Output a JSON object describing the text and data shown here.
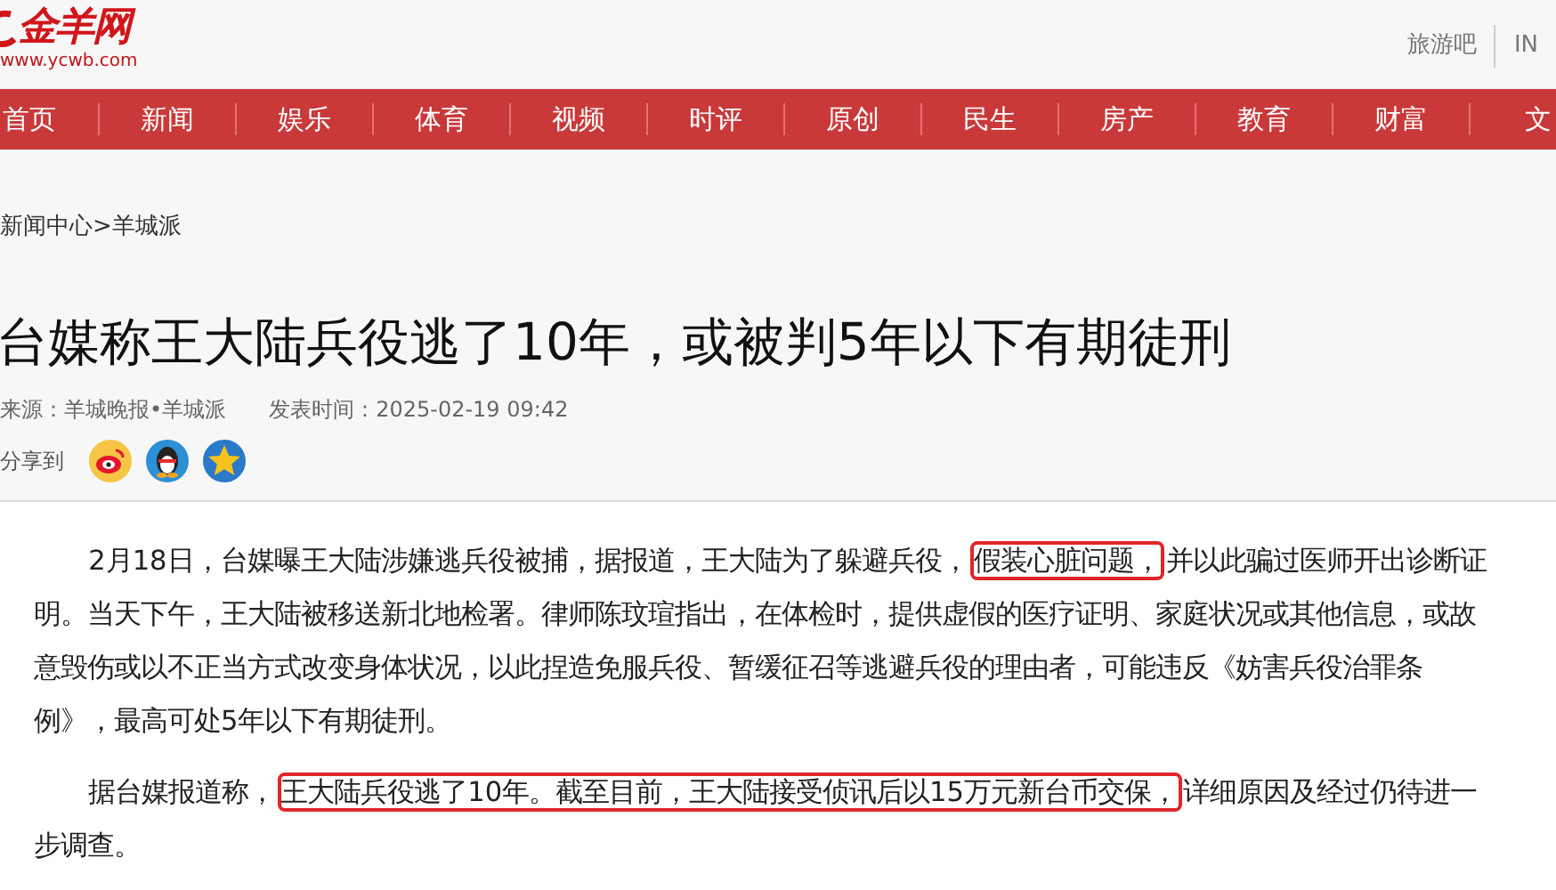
{
  "header": {
    "logo": "金羊网",
    "logo_url": "www.ycwb.com",
    "top_links": [
      "旅游吧",
      "IN"
    ]
  },
  "nav": [
    {
      "label": "首页"
    },
    {
      "label": "新闻"
    },
    {
      "label": "娱乐"
    },
    {
      "label": "体育"
    },
    {
      "label": "视频"
    },
    {
      "label": "时评"
    },
    {
      "label": "原创"
    },
    {
      "label": "民生"
    },
    {
      "label": "房产"
    },
    {
      "label": "教育"
    },
    {
      "label": "财富"
    },
    {
      "label": "文"
    }
  ],
  "breadcrumb": "新闻中心>羊城派",
  "article": {
    "title": "台媒称王大陆兵役逃了10年，或被判5年以下有期徒刑",
    "source": "来源：羊城晚报•羊城派",
    "time": "发表时间：2025-02-19 09:42",
    "share_label": "分享到",
    "share": [
      {
        "kind": "weibo"
      },
      {
        "kind": "qq"
      },
      {
        "kind": "qzone"
      }
    ],
    "paragraphs": [
      [
        {
          "text": "2月18日，台媒曝王大陆涉嫌逃兵役被捕，据报道，王大陆为了躲避兵役，",
          "highlighted": false
        },
        {
          "text": "假装心脏问题，",
          "highlighted": true
        },
        {
          "text": "并以此骗过医师开出诊断证明。当天下午，王大陆被移送新北地检署。律师陈玟瑄指出，在体检时，提供虚假的医疗证明、家庭状况或其他信息，或故意毁伤或以不正当方式改变身体状况，以此捏造免服兵役、暂缓征召等逃避兵役的理由者，可能违反《妨害兵役治罪条例》，最高可处5年以下有期徒刑。",
          "highlighted": false
        }
      ],
      [
        {
          "text": "据台媒报道称，",
          "highlighted": false
        },
        {
          "text": "王大陆兵役逃了10年。截至目前，王大陆接受侦讯后以15万元新台币交保，",
          "highlighted": true
        },
        {
          "text": "详细原因及经过仍待进一步调查。",
          "highlighted": false
        }
      ]
    ]
  }
}
